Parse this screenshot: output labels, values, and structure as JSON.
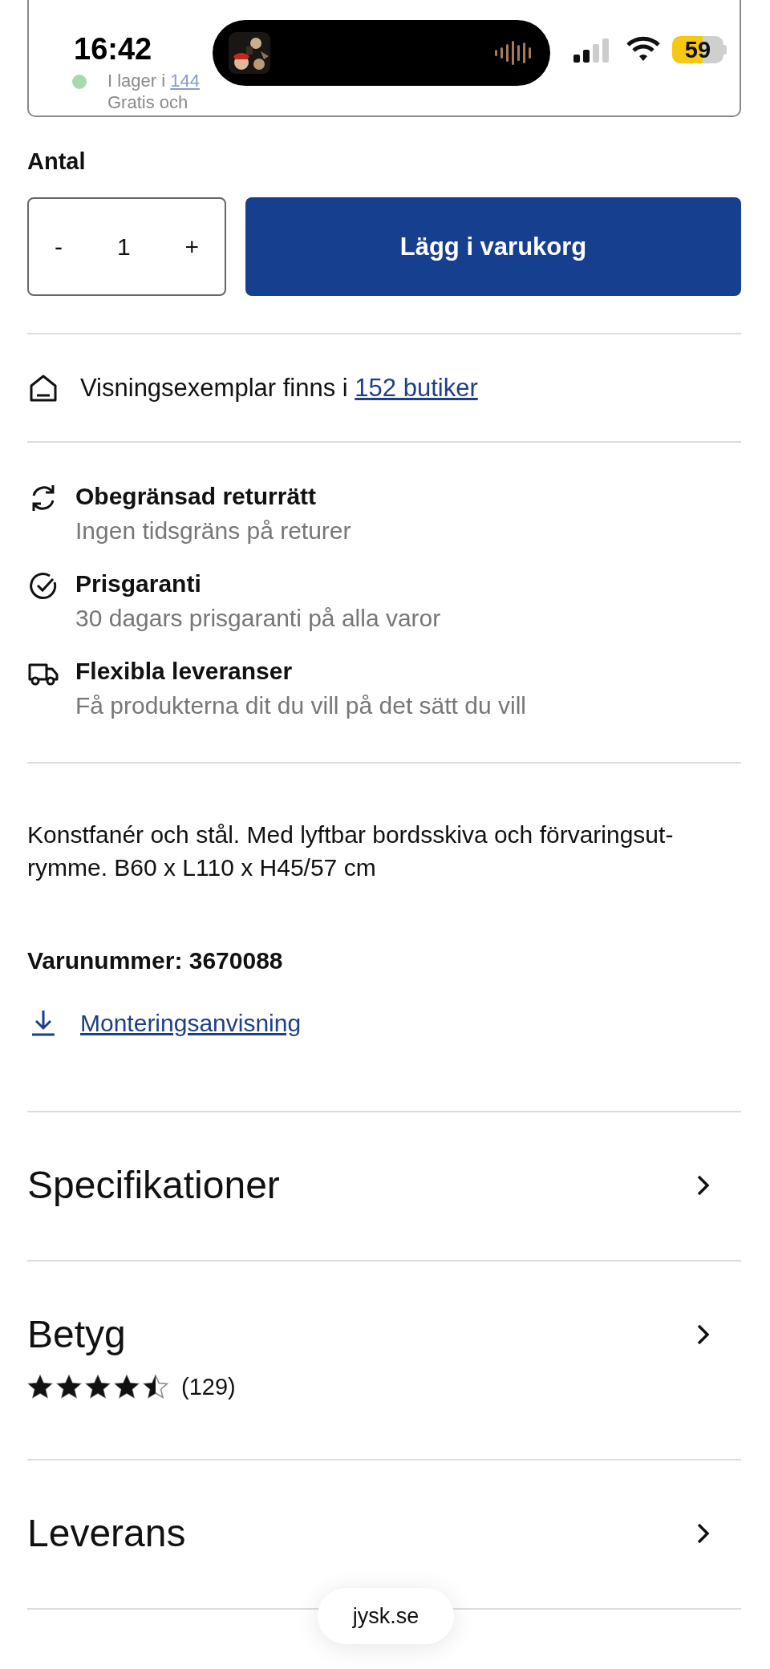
{
  "status_bar": {
    "time": "16:42",
    "battery": "59"
  },
  "stock_card": {
    "stock_text": "I lager i ",
    "stock_link": "144",
    "shipping_text": "Gratis och"
  },
  "quantity": {
    "label": "Antal",
    "minus": "-",
    "value": "1",
    "plus": "+"
  },
  "add_to_cart": "Lägg i varukorg",
  "showroom": {
    "text": "Visningsexemplar finns i ",
    "link": "152 butiker"
  },
  "benefits": [
    {
      "kind": "returns",
      "title": "Obegränsad returrätt",
      "subtitle": "Ingen tidsgräns på returer"
    },
    {
      "kind": "price",
      "title": "Prisgaranti",
      "subtitle": "30 dagars prisgaranti på alla varor"
    },
    {
      "kind": "delivery",
      "title": "Flexibla leveranser",
      "subtitle": "Få produkterna dit du vill på det sätt du vill"
    }
  ],
  "description": {
    "lines": [
      "Konstfanér och stål. Med lyftbar bordsskiva och förvaringsut-",
      "rymme. B60 x L110 x H45/57 cm"
    ]
  },
  "article_number": "Varunummer: 3670088",
  "assembly_link": "Monteringsanvisning",
  "sections": [
    {
      "kind": "plain",
      "title": "Specifikationer"
    },
    {
      "kind": "rating",
      "title": "Betyg",
      "stars": 4.5,
      "count": "(129)"
    },
    {
      "kind": "plain",
      "title": "Leverans"
    }
  ],
  "browser": {
    "url": "jysk.se"
  }
}
